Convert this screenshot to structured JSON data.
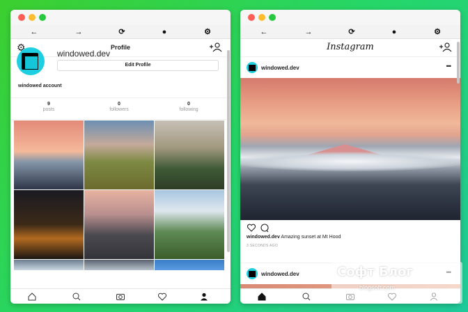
{
  "left_window": {
    "nav": {
      "back": "←",
      "forward": "→",
      "reload": "⟳",
      "account": "●",
      "settings": "⚙"
    },
    "header": {
      "title": "Profile"
    },
    "profile": {
      "username": "windowed.dev",
      "edit_button": "Edit Profile",
      "bio": "windowed account",
      "stats": [
        {
          "value": "9",
          "label": "posts"
        },
        {
          "value": "0",
          "label": "followers"
        },
        {
          "value": "0",
          "label": "following"
        }
      ]
    },
    "tabs": [
      "home-icon",
      "search-icon",
      "camera-icon",
      "heart-icon",
      "profile-icon"
    ]
  },
  "right_window": {
    "nav": {
      "back": "←",
      "forward": "→",
      "reload": "⟳",
      "account": "●",
      "settings": "⚙"
    },
    "header": {
      "logo": "Instagram"
    },
    "post": {
      "username": "windowed.dev",
      "more": "•••",
      "caption_user": "windowed.dev",
      "caption_text": " Amazing sunset at Mt Hood",
      "time": "3 SECONDS AGO"
    },
    "post2": {
      "username": "windowed.dev",
      "more": "•••"
    },
    "tabs": [
      "home-icon",
      "search-icon",
      "camera-icon",
      "heart-icon",
      "profile-icon"
    ]
  },
  "watermark": {
    "title": "Софт Блог",
    "subtitle": "blogsoft.com"
  },
  "colors": {
    "background": "#2ad15a",
    "avatar": "#1dcfe0",
    "close": "#fd5f57",
    "minimize": "#febc2e",
    "zoom": "#28c840"
  }
}
